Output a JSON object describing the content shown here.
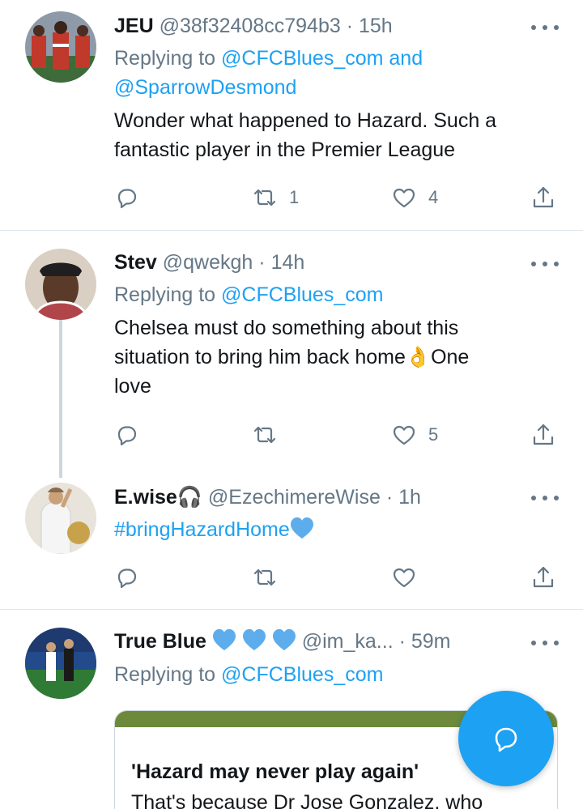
{
  "tweets": [
    {
      "name": "JEU",
      "handle": "@38f32408cc794b3",
      "sep": "·",
      "time": "15h",
      "replying_prefix": "Replying to",
      "replying_line1": "@CFCBlues_com and",
      "replying_line2": "@SparrowDesmond",
      "text_line1": "Wonder what happened to Hazard. Such a",
      "text_line2": "fantastic player in the Premier League",
      "retweets": "1",
      "likes": "4"
    },
    {
      "name": "Stev",
      "handle": "@qwekgh",
      "sep": "·",
      "time": "14h",
      "replying_prefix": "Replying to",
      "replying_to": "@CFCBlues_com",
      "text_line1": "Chelsea must do something about this",
      "text_line2a": "situation to bring him back home",
      "text_emoji": "👌",
      "text_line2b": "One",
      "text_line3": "love",
      "retweets": "",
      "likes": "5"
    },
    {
      "name": "E.wise",
      "name_emoji": "🎧",
      "handle": "@EzechimereWise",
      "sep": "·",
      "time": "1h",
      "hashtag": "#bringHazardHome",
      "retweets": "",
      "likes": ""
    },
    {
      "name": "True Blue",
      "handle": "@im_ka...",
      "sep": "·",
      "time": "59m",
      "replying_prefix": "Replying to",
      "replying_to": "@CFCBlues_com",
      "card_title": "'Hazard may never play again'",
      "card_desc": "That's because Dr Jose Gonzalez, who"
    }
  ],
  "icons": {
    "reply": "reply-icon",
    "retweet": "retweet-icon",
    "like": "heart-icon",
    "share": "share-icon",
    "more": "more-icon",
    "compose": "compose-reply-icon"
  },
  "colors": {
    "link": "#1da1f2",
    "meta": "#657786",
    "heart_emoji": "#5dadec",
    "divider": "#e1e8ed"
  }
}
